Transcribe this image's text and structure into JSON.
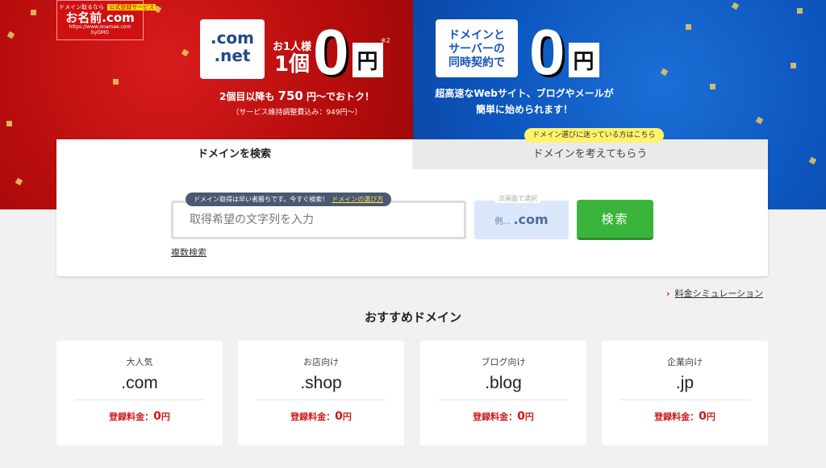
{
  "logo": {
    "tagline_left": "ドメイン取るなら",
    "tagline_badge": "公式登録サービス",
    "brand": "お名前.com",
    "tlds": ".com .jp .co.jp",
    "url": "https://www.onamae.com",
    "group": "byGMO"
  },
  "promo_left": {
    "card": ".com\n.net",
    "per_person_top": "お1人様",
    "per_person_bottom": "1個",
    "price": "0",
    "unit": "円",
    "note": "※2",
    "line1_prefix": "2個目以降も",
    "line1_price": "750",
    "line1_suffix": "円～でおトク！",
    "line2": "（サービス維持調整費込み：949円～）"
  },
  "promo_right": {
    "card": "ドメインと\nサーバーの\n同時契約で",
    "price": "0",
    "unit": "円",
    "line1": "超高速なWebサイト、ブログやメールが",
    "line2": "簡単に始められます！"
  },
  "tabs": {
    "search": "ドメインを検索",
    "think": "ドメインを考えてもらう",
    "think_bubble": "ドメイン選びに迷っている方はこちら"
  },
  "search": {
    "tip": "ドメイン取得は早い者勝ちです。今すぐ検索！",
    "tip_link": "ドメインの選び方",
    "placeholder": "取得希望の文字列を入力",
    "tld_hint": "次画面で選択",
    "tld_example": "例…",
    "tld_value": ".com",
    "button": "検索",
    "multi": "複数検索"
  },
  "simulation_link": "料金シミュレーション",
  "recommend": {
    "title": "おすすめドメイン",
    "price_label": "登録料金：",
    "items": [
      {
        "category": "大人気",
        "tld": ".com",
        "price": "0",
        "unit": "円"
      },
      {
        "category": "お店向け",
        "tld": ".shop",
        "price": "0",
        "unit": "円"
      },
      {
        "category": "ブログ向け",
        "tld": ".blog",
        "price": "0",
        "unit": "円"
      },
      {
        "category": "企業向け",
        "tld": ".jp",
        "price": "0",
        "unit": "円"
      }
    ]
  },
  "colors": {
    "red": "#c01212",
    "blue": "#1160c8",
    "green": "#3ab43a",
    "price_red": "#cc1818"
  }
}
